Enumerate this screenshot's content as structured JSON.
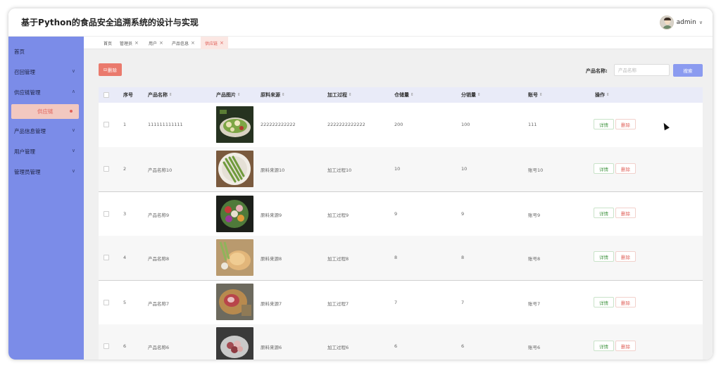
{
  "app": {
    "title": "基于Python的食品安全追溯系统的设计与实现"
  },
  "user": {
    "name": "admin",
    "chevron": "∨"
  },
  "sidebar": {
    "items": [
      {
        "label": "首页",
        "chevron": ""
      },
      {
        "label": "召回管理",
        "chevron": "∨"
      },
      {
        "label": "供应链管理",
        "chevron": "∧"
      },
      {
        "label": "产品信息管理",
        "chevron": "∨"
      },
      {
        "label": "用户管理",
        "chevron": "∨"
      },
      {
        "label": "管理员管理",
        "chevron": "∨"
      }
    ],
    "active_sub": "供应链"
  },
  "tabs": [
    {
      "label": "首页",
      "close": ""
    },
    {
      "label": "管理员",
      "close": "×"
    },
    {
      "label": "用户",
      "close": "×"
    },
    {
      "label": "产品信息",
      "close": "×"
    },
    {
      "label": "供应链",
      "close": "×"
    }
  ],
  "toolbar": {
    "delete_label": "删除",
    "delete_icon": "⊟"
  },
  "search": {
    "label": "产品名称:",
    "placeholder": "产品名称",
    "button": "搜索"
  },
  "table": {
    "headers": [
      "序号",
      "产品名称",
      "产品图片",
      "原料来源",
      "加工过程",
      "仓储量",
      "分销量",
      "账号",
      "操作"
    ],
    "sort_icon": "⇕",
    "rows": [
      {
        "index": "1",
        "name": "111111111111",
        "source": "222222222222",
        "process": "2222222222222",
        "storage": "200",
        "sales": "100",
        "account": "111",
        "image": "salad-bowl"
      },
      {
        "index": "2",
        "name": "产品名称10",
        "source": "原料来源10",
        "process": "加工过程10",
        "storage": "10",
        "sales": "10",
        "account": "账号10",
        "image": "asparagus-plate"
      },
      {
        "index": "3",
        "name": "产品名称9",
        "source": "原料来源9",
        "process": "加工过程9",
        "storage": "9",
        "sales": "9",
        "account": "账号9",
        "image": "vegetable-platter"
      },
      {
        "index": "4",
        "name": "产品名称8",
        "source": "原料来源8",
        "process": "加工过程8",
        "storage": "8",
        "sales": "8",
        "account": "账号8",
        "image": "roast-chicken"
      },
      {
        "index": "5",
        "name": "产品名称7",
        "source": "原料来源7",
        "process": "加工过程7",
        "storage": "7",
        "sales": "7",
        "account": "账号7",
        "image": "meat-board"
      },
      {
        "index": "6",
        "name": "产品名称6",
        "source": "原料来源6",
        "process": "加工过程6",
        "storage": "6",
        "sales": "6",
        "account": "账号6",
        "image": "meat-bowl"
      }
    ],
    "detail_label": "详情",
    "delete_label": "删除"
  },
  "colors": {
    "sidebar": "#7b8ce8",
    "accent_red": "#e0615a",
    "search_button": "#8b9bf0",
    "header_row": "#e9ebf8"
  }
}
